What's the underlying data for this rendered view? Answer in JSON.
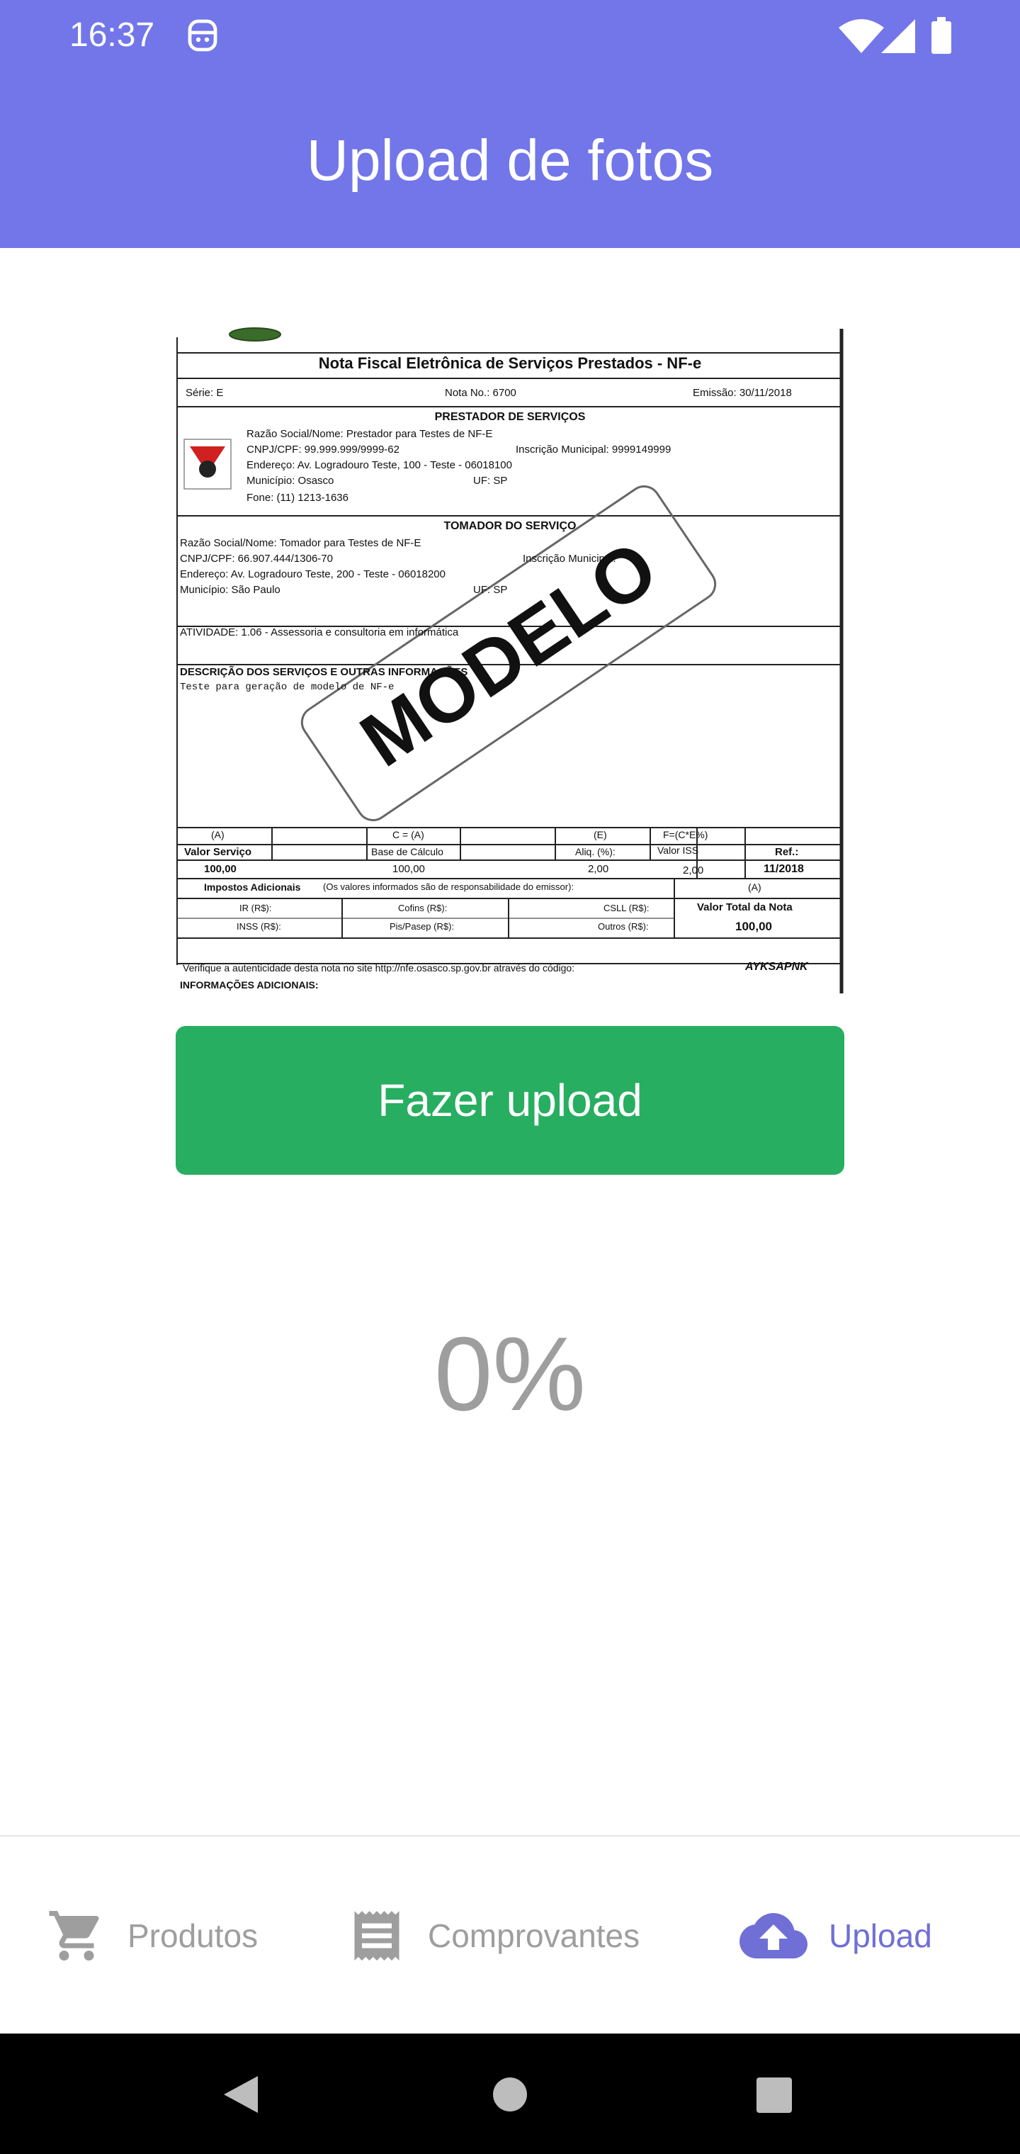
{
  "status": {
    "time": "16:37"
  },
  "appbar": {
    "title": "Upload de fotos"
  },
  "document": {
    "title": "Nota Fiscal Eletrônica de Serviços Prestados - NF-e",
    "serie": "Série:  E",
    "nota": "Nota No.:  6700",
    "emissao": "Emissão:  30/11/2018",
    "prestador_header": "PRESTADOR DE SERVIÇOS",
    "prestador_razao": "Razão Social/Nome: Prestador para Testes de NF-E",
    "prestador_cnpj": "CNPJ/CPF: 99.999.999/9999-62",
    "prestador_im": "Inscrição Municipal:  9999149999",
    "prestador_endereco": "Endereço:  Av. Logradouro Teste, 100 - Teste - 06018100",
    "prestador_municipio": "Município:  Osasco",
    "prestador_uf": "UF: SP",
    "prestador_fone": "Fone:  (11) 1213-1636",
    "tomador_header": "TOMADOR DO SERVIÇO",
    "tomador_razao": "Razão Social/Nome: Tomador para Testes de NF-E",
    "tomador_cnpj": "CNPJ/CPF: 66.907.444/1306-70",
    "tomador_im": "Inscrição Municipal:",
    "tomador_endereco": "Endereço: Av. Logradouro Teste, 200 - Teste - 06018200",
    "tomador_municipio": "Município: São Paulo",
    "tomador_uf": "UF: SP",
    "atividade": "ATIVIDADE: 1.06 - Assessoria e consultoria em informática",
    "descricao_header": "DESCRIÇÃO DOS SERVIÇOS E OUTRAS INFORMAÇÕES",
    "descricao_text": "Teste para geração de modelo de NF-e",
    "stamp": "MODELO",
    "col_a": "(A)",
    "col_c": "C = (A)",
    "col_e": "(E)",
    "col_f": "F=(C*E%)",
    "valor_servico": "Valor Serviço",
    "base_calculo": "Base de Cálculo",
    "aliq": "Aliq. (%):",
    "valor_iss": "Valor ISS",
    "ref": "Ref.:",
    "v_valor": "100,00",
    "v_base": "100,00",
    "v_aliq": "2,00",
    "v_iss": "2,00",
    "v_ref": "11/2018",
    "impostos": "Impostos Adicionais",
    "impostos_note": "(Os valores informados são de responsabilidade do emissor):",
    "imp_a": "(A)",
    "ir": "IR (R$):",
    "cofins": "Cofins (R$):",
    "csll": "CSLL (R$):",
    "inss": "INSS (R$):",
    "pis": "Pis/Pasep (R$):",
    "outros": "Outros (R$):",
    "valor_total_label": "Valor Total da Nota",
    "valor_total": "100,00",
    "verifique": "Verifique a autenticidade desta nota no site http://nfe.osasco.sp.gov.br através do código:",
    "codigo": "AYKSAPNK",
    "info_adicionais": "INFORMAÇÕES ADICIONAIS:"
  },
  "upload_button": {
    "label": "Fazer upload"
  },
  "progress": {
    "text": "0%"
  },
  "nav": {
    "produtos": "Produtos",
    "comprovantes": "Comprovantes",
    "upload": "Upload"
  },
  "colors": {
    "primary": "#7276E9",
    "button": "#27AE60",
    "active": "#6F6FD6",
    "inactive": "#9e9e9e"
  }
}
